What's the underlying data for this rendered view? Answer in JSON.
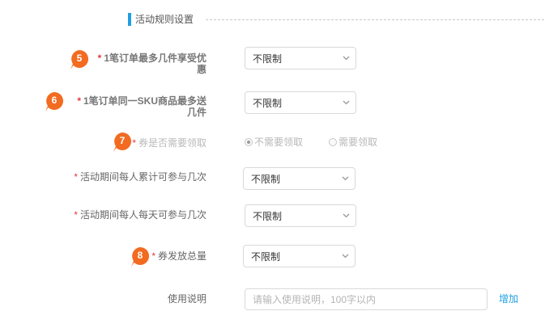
{
  "section": {
    "title": "活动规则设置",
    "accent_color": "#1e9fe3"
  },
  "badge_color": "#f26b21",
  "required_mark": "*",
  "fields": [
    {
      "badge": "5",
      "label_line1": "1笔订单最多几件享受优",
      "label_line2": "惠",
      "value": "不限制"
    },
    {
      "badge": "6",
      "label_line1": "1笔订单同一SKU商品最多送",
      "label_line2": "几件",
      "value": "不限制"
    },
    {
      "badge": "7",
      "label": "券是否需要领取",
      "options": [
        {
          "label": "不需要领取",
          "selected": true
        },
        {
          "label": "需要领取",
          "selected": false
        }
      ]
    },
    {
      "label": "活动期间每人累计可参与几次",
      "value": "不限制"
    },
    {
      "label": "活动期间每人每天可参与几次",
      "value": "不限制"
    },
    {
      "badge": "8",
      "label": "券发放总量",
      "value": "不限制"
    },
    {
      "label": "使用说明",
      "placeholder": "请输入使用说明，100字以内",
      "value": "",
      "add_label": "增加"
    }
  ]
}
